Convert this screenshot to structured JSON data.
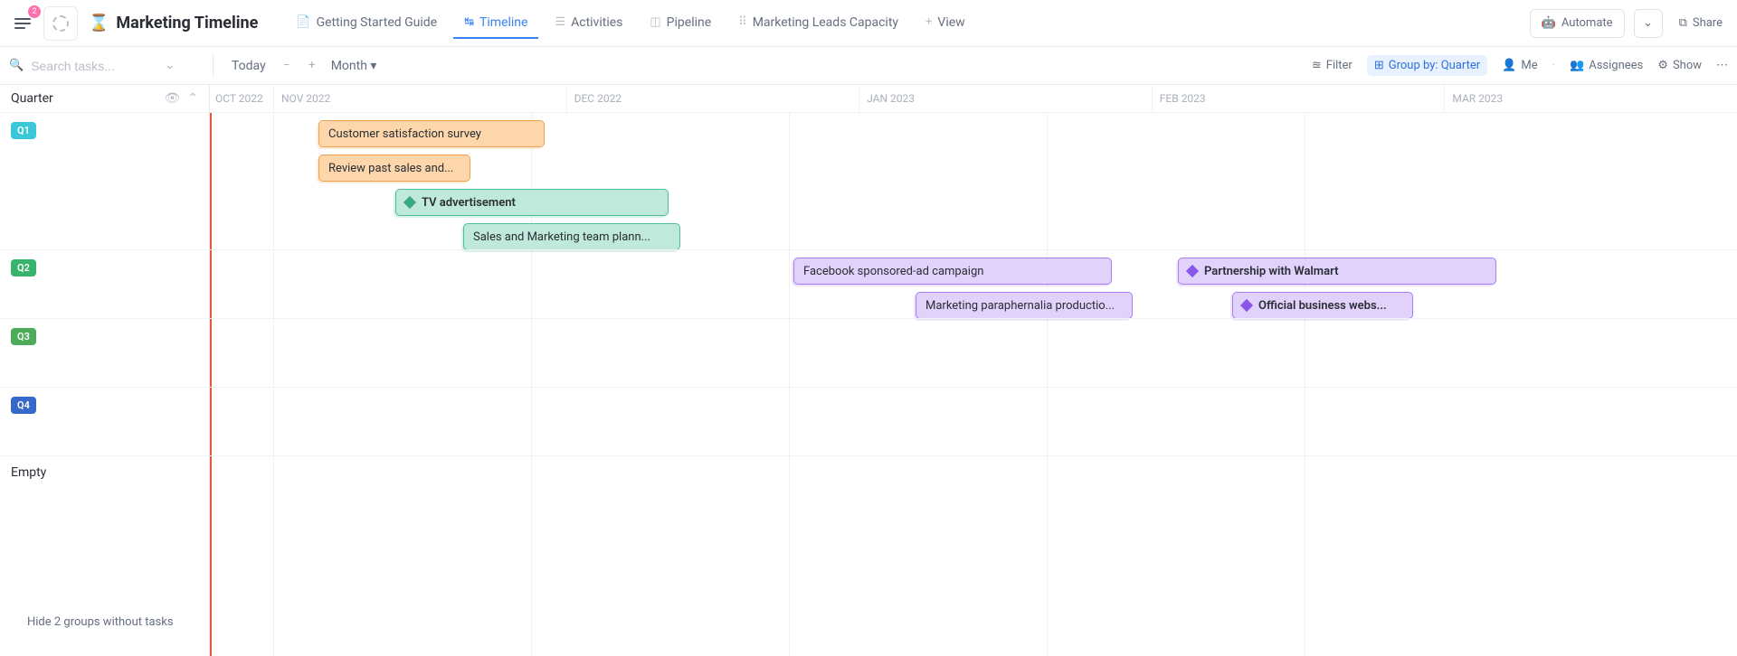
{
  "header": {
    "notif_count": "2",
    "title": "Marketing Timeline",
    "views": [
      {
        "label": "Getting Started Guide",
        "icon": "📄"
      },
      {
        "label": "Timeline",
        "icon": "↹"
      },
      {
        "label": "Activities",
        "icon": "☰"
      },
      {
        "label": "Pipeline",
        "icon": "◫"
      },
      {
        "label": "Marketing Leads Capacity",
        "icon": "⠿"
      },
      {
        "label": "View",
        "icon": "+"
      }
    ],
    "automate": "Automate",
    "share": "Share"
  },
  "toolbar": {
    "search_placeholder": "Search tasks...",
    "today": "Today",
    "zoom": "Month",
    "filter": "Filter",
    "group_by": "Group by: Quarter",
    "me": "Me",
    "assignees": "Assignees",
    "show": "Show"
  },
  "sidebar": {
    "heading": "Quarter",
    "q1": "Q1",
    "q2": "Q2",
    "q3": "Q3",
    "q4": "Q4",
    "empty": "Empty",
    "hide_note": "Hide 2 groups without tasks"
  },
  "timeline": {
    "months": [
      "OCT 2022",
      "NOV 2022",
      "DEC 2022",
      "JAN 2023",
      "FEB 2023",
      "MAR 2023"
    ],
    "tasks": {
      "t1": "Customer satisfaction survey",
      "t2": "Review past sales and...",
      "t3": "TV advertisement",
      "t4": "Sales and Marketing team plann...",
      "t5": "Facebook sponsored-ad campaign",
      "t6": "Marketing paraphernalia productio...",
      "t7": "Partnership with Walmart",
      "t8": "Official business webs..."
    }
  }
}
